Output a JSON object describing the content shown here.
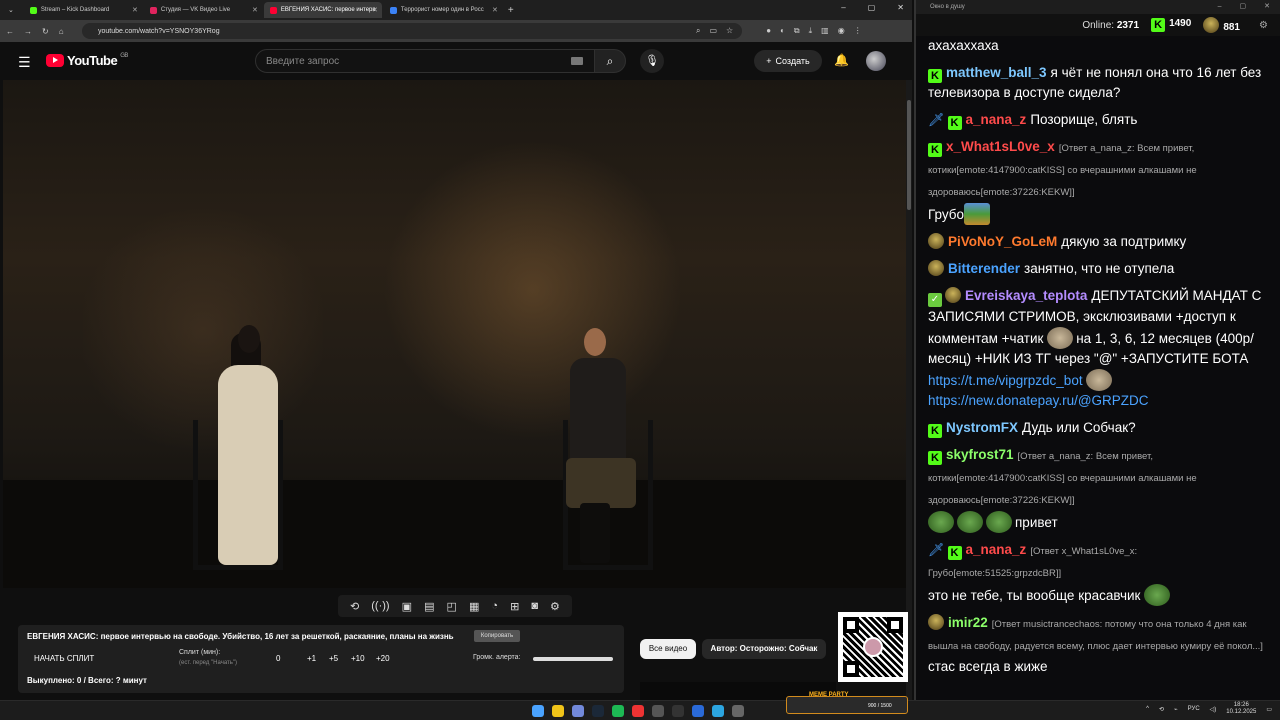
{
  "browser": {
    "tabs": [
      {
        "label": "Stream – Kick Dashboard",
        "color": "#53fc18"
      },
      {
        "label": "Студия — VK Видео Live",
        "color": "#e0245e"
      },
      {
        "label": "ЕВГЕНИЯ ХАСИС: первое интерв",
        "color": "#ff0033"
      },
      {
        "label": "Террорист номер один в Росс",
        "color": "#3b82f6"
      }
    ],
    "url": "youtube.com/watch?v=YSNOY36YRog"
  },
  "youtube": {
    "logo": "YouTube",
    "region": "GB",
    "search_placeholder": "Введите запрос",
    "create_label": "Создать"
  },
  "panel": {
    "title": "ЕВГЕНИЯ ХАСИС: первое интервью на свободе. Убийство, 16 лет за решеткой, раскаяние, планы на жизнь",
    "copy_label": "Копировать",
    "split_button": "НАЧАТЬ СПЛИТ",
    "split_label": "Сплит (мин):",
    "split_hint": "(ест. перед \"Начать\")",
    "split_value": "0",
    "increments": [
      "+1",
      "+5",
      "+10",
      "+20"
    ],
    "alert_label": "Громк. алерта:",
    "bought": "Выкуплено: 0 / Всего: ? минут"
  },
  "filters": {
    "all_videos": "Все видео",
    "author": "Автор: Осторожно: Собчак"
  },
  "chat": {
    "window_title": "Окно в душу",
    "online_label": "Online:",
    "online_count": "2371",
    "kick_count": "1490",
    "other_count": "881",
    "messages": [
      {
        "user": "",
        "text": "ахахаххаха"
      },
      {
        "user": "matthew_ball_3",
        "color": "#7ec8ff",
        "text": "я чёт не понял она что 16 лет без телевизора в доступе сидела?"
      },
      {
        "user": "a_nana_z",
        "color": "#ff4b4b",
        "text": "Позорище, блять"
      },
      {
        "user": "x_What1sL0ve_x",
        "color": "#ff4b4b",
        "reply": "[Ответ a_nana_z: Всем привет, котики[emote:4147900:catKISS] со вчерашними алкашами не здороваюсь[emote:37226:KEKW]]",
        "text": "Грубо"
      },
      {
        "user": "PiVoNoY_GoLeM",
        "color": "#ff7a2e",
        "text": "дякую за подтримку"
      },
      {
        "user": "Bitterender",
        "color": "#4ba3ff",
        "text": "занятно, что не отупела"
      },
      {
        "user": "Evreiskaya_teplota",
        "color": "#b48cff",
        "text": "ДЕПУТАТСКИЙ МАНДАТ С ЗАПИСЯМИ СТРИМОВ, эксклюзивами +доступ к комментам +чатик",
        "text2": "на 1, 3, 6, 12 месяцев (400р/месяц) +НИК ИЗ ТГ через \"@\" +ЗАПУСТИТЕ БОТА",
        "link1": "https://t.me/vipgrpzdc_bot",
        "link2": "https://new.donatepay.ru/@GRPZDC"
      },
      {
        "user": "NystromFX",
        "color": "#7ec8ff",
        "text": "Дудь или Собчак?"
      },
      {
        "user": "skyfrost71",
        "color": "#8cff6a",
        "reply": "[Ответ a_nana_z: Всем привет, котики[emote:4147900:catKISS] со вчерашними алкашами не здороваюсь[emote:37226:KEKW]]",
        "text": "привет"
      },
      {
        "user": "a_nana_z",
        "color": "#ff4b4b",
        "reply": "[Ответ x_What1sL0ve_x: Грубо[emote:51525:grpzdcBR]]",
        "text": "это не тебе, ты вообще красавчик"
      },
      {
        "user": "imir22",
        "color": "#8cff6a",
        "reply": "[Ответ musictrancechaos: потому что она только 4 дня как вышла на свободу, радуется всему, плюс дает интервью кумиру её покол...]",
        "text": "стас всегда в жиже"
      }
    ]
  },
  "taskbar": {
    "meme_label": "MEME PARTY",
    "meme_progress": "900 / 1500",
    "lang": "РУС",
    "time": "18:26",
    "date": "10.12.2025"
  }
}
